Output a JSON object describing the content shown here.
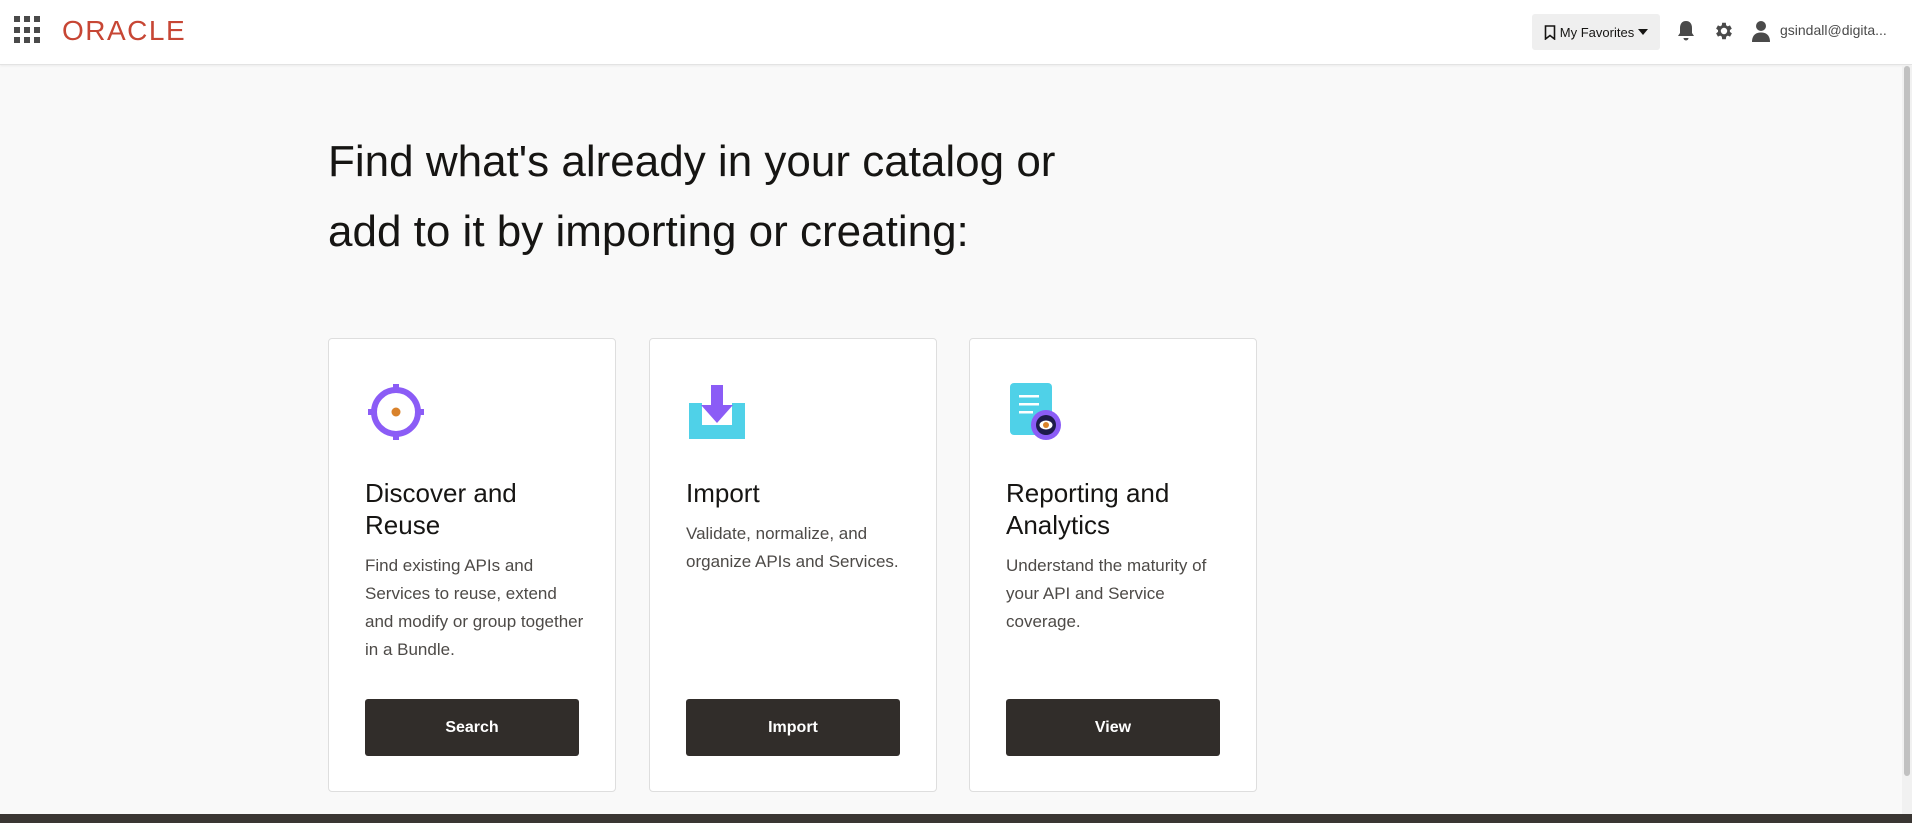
{
  "header": {
    "logo_text": "ORACLE",
    "favorites_label": "My Favorites",
    "username": "gsindall@digita..."
  },
  "main": {
    "headline_line1": "Find what's already in your catalog or",
    "headline_line2": "add to it by importing or creating:",
    "cards": [
      {
        "title": "Discover and Reuse",
        "description": "Find existing APIs and Services to reuse, extend and modify or group together in a Bundle.",
        "button_label": "Search",
        "icon": "target-icon"
      },
      {
        "title": "Import",
        "description": "Validate, normalize, and organize APIs and Services.",
        "button_label": "Import",
        "icon": "import-tray-icon"
      },
      {
        "title": "Reporting and Analytics",
        "description": "Understand the maturity of your API and Service coverage.",
        "button_label": "View",
        "icon": "report-eye-icon"
      }
    ]
  },
  "colors": {
    "brand_red": "#c74634",
    "button_dark": "#312d2a",
    "purple_accent": "#8b5cf6",
    "cyan_accent": "#4fd1e8"
  }
}
